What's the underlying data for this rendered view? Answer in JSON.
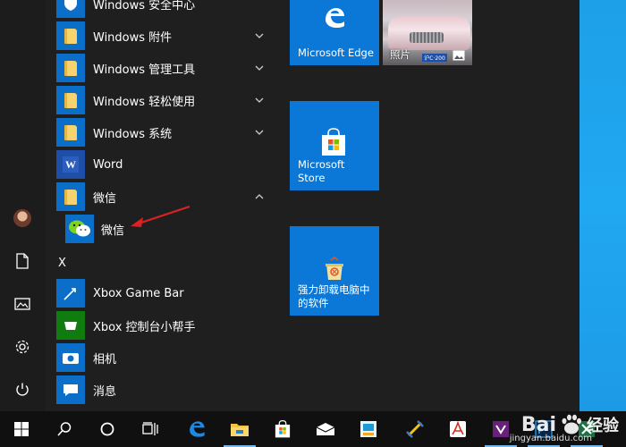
{
  "start_menu": {
    "apps": [
      {
        "label": "Windows 安全中心",
        "type": "app-partial"
      },
      {
        "label": "Windows 附件",
        "type": "folder",
        "expanded": false
      },
      {
        "label": "Windows 管理工具",
        "type": "folder",
        "expanded": false
      },
      {
        "label": "Windows 轻松使用",
        "type": "folder",
        "expanded": false
      },
      {
        "label": "Windows 系统",
        "type": "folder",
        "expanded": false
      },
      {
        "label": "Word",
        "type": "app"
      },
      {
        "label": "微信",
        "type": "folder",
        "expanded": true
      }
    ],
    "wechat_child": {
      "label": "微信"
    },
    "section_x": "X",
    "apps_x": [
      {
        "label": "Xbox Game Bar"
      },
      {
        "label": "Xbox 控制台小帮手"
      },
      {
        "label": "相机"
      },
      {
        "label": "消息"
      }
    ]
  },
  "tiles": {
    "edge": {
      "label": "Microsoft Edge"
    },
    "photos": {
      "label": "照片",
      "plate": "沪C·200"
    },
    "store": {
      "label": "Microsoft Store"
    },
    "uninstall": {
      "label": "强力卸载电脑中的软件"
    }
  },
  "taskbar": {
    "items": [
      "start-icon",
      "search-icon",
      "cortana-icon",
      "task-view-icon",
      "edge-icon",
      "file-explorer-icon",
      "store-icon",
      "mail-icon",
      "app-icon",
      "tool-icon",
      "acrobat-icon",
      "visual-studio-icon",
      "photoshop-icon",
      "excel-icon"
    ]
  },
  "watermark": {
    "brand": "Bai",
    "brand_suffix": "经验",
    "url": "jingyan.baidu.com"
  },
  "colors": {
    "tile_blue": "#0b78d8",
    "folder_blue": "#0b6fc9",
    "arrow_red": "#e02020",
    "wallpaper": "#1da0e8"
  }
}
